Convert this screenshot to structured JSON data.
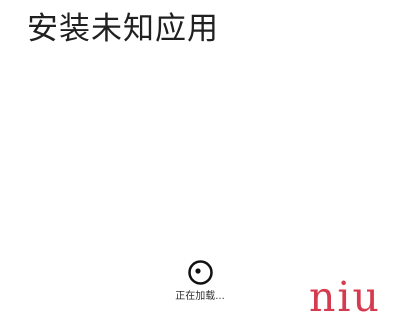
{
  "page": {
    "title": "安装未知应用"
  },
  "loading": {
    "icon": "loading-spinner-icon",
    "text": "正在加载..."
  },
  "watermark": {
    "text": "niu",
    "color": "#d63a4f"
  }
}
